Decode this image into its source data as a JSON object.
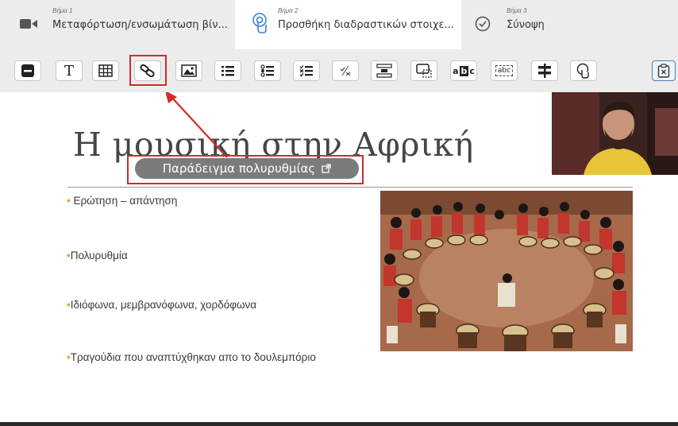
{
  "steps": [
    {
      "step": "Βήμα 1",
      "title": "Μεταφόρτωση/ενσωμάτωση βίν...",
      "icon": "video-camera-icon"
    },
    {
      "step": "Βήμα 2",
      "title": "Προσθήκη διαδραστικών στοιχε...",
      "icon": "touch-icon"
    },
    {
      "step": "Βήμα 3",
      "title": "Σύνοψη",
      "icon": "check-circle-icon"
    }
  ],
  "toolbar": {
    "text_tool": "T",
    "label_tool": "abc",
    "fill_tool": "a",
    "fill_tool_box": "b",
    "fill_tool_end": "c"
  },
  "slide": {
    "title": "Η μουσική στην Αφρική",
    "link_text": "Παράδειγμα πολυρυθμίας",
    "bullets": [
      "Ερώτηση – απάντηση",
      "Πολυρυθμία",
      "Ιδιόφωνα, μεμβρανόφωνα, χορδόφωνα",
      "Τραγούδια που αναπτύχθηκαν απο το δουλεμπόριο"
    ],
    "bullet_marker": "•"
  },
  "colors": {
    "highlight": "#d42a2a",
    "bullet": "#e8a53a",
    "active_icon": "#3b7dd8",
    "link_badge": "#7b7b7b"
  }
}
